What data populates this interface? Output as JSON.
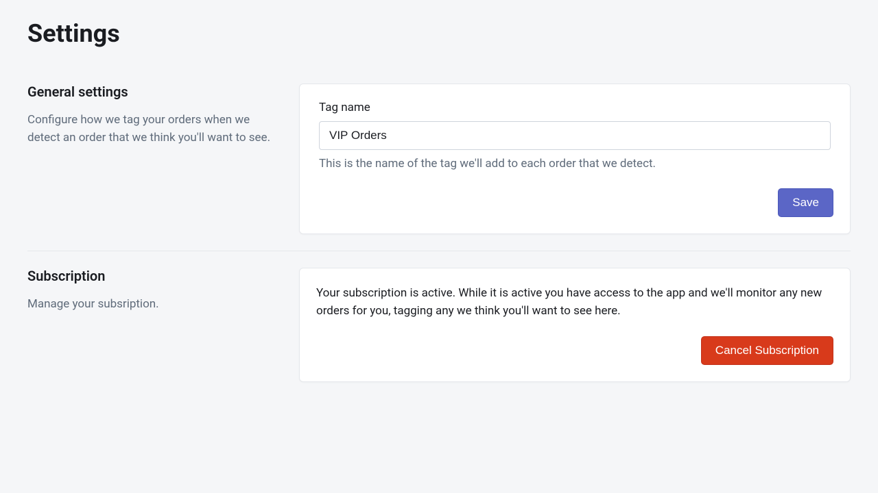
{
  "page": {
    "title": "Settings"
  },
  "general": {
    "heading": "General settings",
    "description": "Configure how we tag your orders when we detect an order that we think you'll want to see.",
    "tag_name_label": "Tag name",
    "tag_name_value": "VIP Orders",
    "tag_name_help": "This is the name of the tag we'll add to each order that we detect.",
    "save_label": "Save"
  },
  "subscription": {
    "heading": "Subscription",
    "description": "Manage your subsription.",
    "status_text": "Your subscription is active. While it is active you have access to the app and we'll monitor any new orders for you, tagging any we think you'll want to see here.",
    "cancel_label": "Cancel Subscription"
  }
}
